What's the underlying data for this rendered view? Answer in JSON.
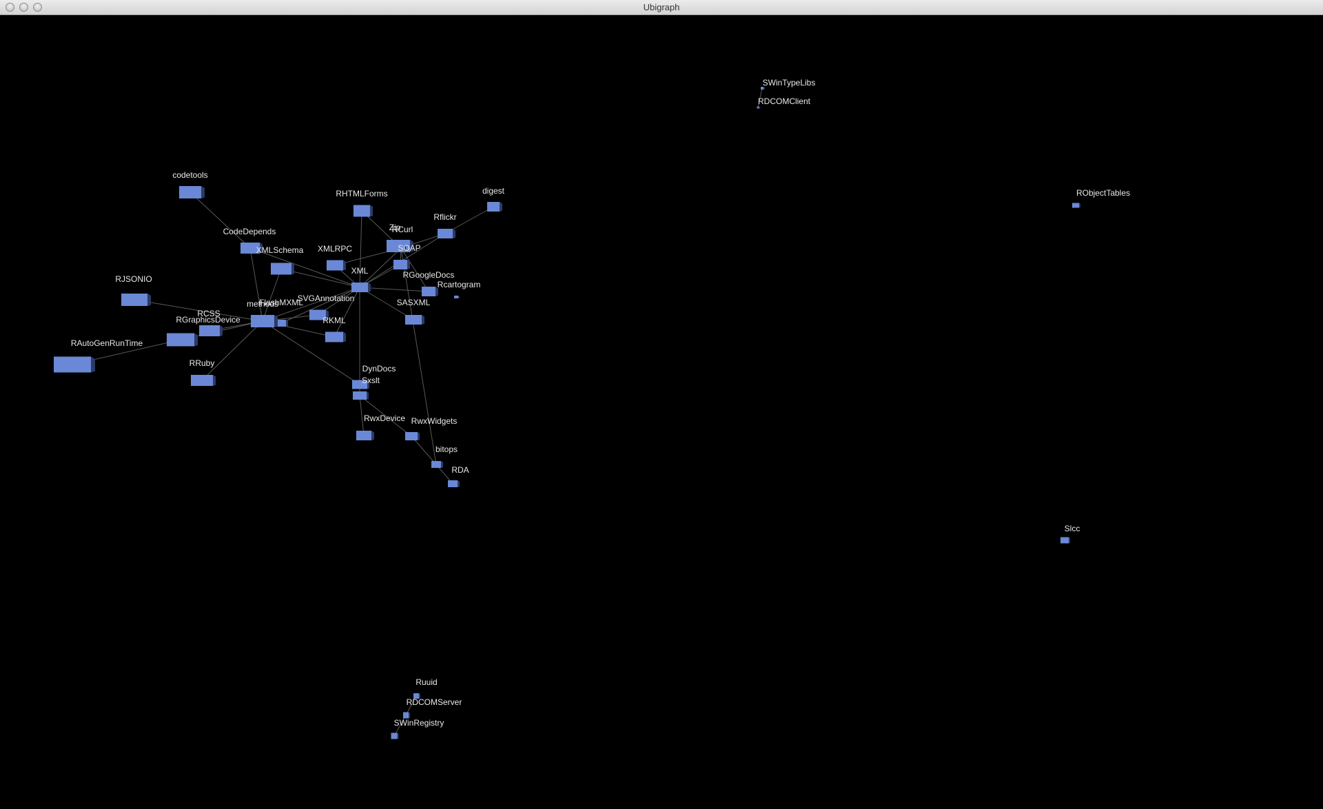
{
  "window": {
    "title": "Ubigraph"
  },
  "graph": {
    "node_color": "#6a88d6",
    "node_shadow": "#2c3b66",
    "edge_color": "#5a5a5a",
    "nodes": [
      {
        "id": "codetools",
        "label": "codetools"
      },
      {
        "id": "CodeDepends",
        "label": "CodeDepends"
      },
      {
        "id": "XMLSchema",
        "label": "XMLSchema"
      },
      {
        "id": "XMLRPC",
        "label": "XMLRPC"
      },
      {
        "id": "RHTMLForms",
        "label": "RHTMLForms"
      },
      {
        "id": "Zip",
        "label": "Zip"
      },
      {
        "id": "RCurl",
        "label": "RCurl"
      },
      {
        "id": "SOAP",
        "label": "SOAP"
      },
      {
        "id": "Rflickr",
        "label": "Rflickr"
      },
      {
        "id": "digest",
        "label": "digest"
      },
      {
        "id": "XML",
        "label": "XML"
      },
      {
        "id": "RGoogleDocs",
        "label": "RGoogleDocs"
      },
      {
        "id": "Rcartogram",
        "label": "Rcartogram"
      },
      {
        "id": "SASXML",
        "label": "SASXML"
      },
      {
        "id": "RJSONIO",
        "label": "RJSONIO"
      },
      {
        "id": "FlashMXML",
        "label": "FlashMXML"
      },
      {
        "id": "methods",
        "label": "methods"
      },
      {
        "id": "SVGAnnotation",
        "label": "SVGAnnotation"
      },
      {
        "id": "RCSS",
        "label": "RCSS"
      },
      {
        "id": "RGraphicsDevice",
        "label": "RGraphicsDevice"
      },
      {
        "id": "RKML",
        "label": "RKML"
      },
      {
        "id": "RAutoGenRunTime",
        "label": "RAutoGenRunTime"
      },
      {
        "id": "RRuby",
        "label": "RRuby"
      },
      {
        "id": "DynDocs",
        "label": "DynDocs"
      },
      {
        "id": "Sxslt",
        "label": "Sxslt"
      },
      {
        "id": "RwxDevice",
        "label": "RwxDevice"
      },
      {
        "id": "RwxWidgets",
        "label": "RwxWidgets"
      },
      {
        "id": "bitops",
        "label": "bitops"
      },
      {
        "id": "RDA",
        "label": "RDA"
      },
      {
        "id": "SWinTypeLibs",
        "label": "SWinTypeLibs"
      },
      {
        "id": "RDCOMClient",
        "label": "RDCOMClient"
      },
      {
        "id": "RObjectTables",
        "label": "RObjectTables"
      },
      {
        "id": "Slcc",
        "label": "Slcc"
      },
      {
        "id": "Ruuid",
        "label": "Ruuid"
      },
      {
        "id": "RDCOMServer",
        "label": "RDCOMServer"
      },
      {
        "id": "SWinRegistry",
        "label": "SWinRegistry"
      }
    ],
    "edges": [
      [
        "codetools",
        "CodeDepends"
      ],
      [
        "CodeDepends",
        "XML"
      ],
      [
        "CodeDepends",
        "methods"
      ],
      [
        "XMLSchema",
        "XML"
      ],
      [
        "XMLSchema",
        "methods"
      ],
      [
        "XMLRPC",
        "XML"
      ],
      [
        "XMLRPC",
        "RCurl"
      ],
      [
        "RHTMLForms",
        "XML"
      ],
      [
        "RHTMLForms",
        "RCurl"
      ],
      [
        "RCurl",
        "XML"
      ],
      [
        "RCurl",
        "bitops"
      ],
      [
        "SOAP",
        "XML"
      ],
      [
        "SOAP",
        "RCurl"
      ],
      [
        "Rflickr",
        "RCurl"
      ],
      [
        "Rflickr",
        "XML"
      ],
      [
        "Rflickr",
        "digest"
      ],
      [
        "RGoogleDocs",
        "XML"
      ],
      [
        "RGoogleDocs",
        "RCurl"
      ],
      [
        "SASXML",
        "XML"
      ],
      [
        "XML",
        "methods"
      ],
      [
        "SVGAnnotation",
        "XML"
      ],
      [
        "SVGAnnotation",
        "methods"
      ],
      [
        "FlashMXML",
        "XML"
      ],
      [
        "FlashMXML",
        "methods"
      ],
      [
        "RKML",
        "XML"
      ],
      [
        "RKML",
        "methods"
      ],
      [
        "RJSONIO",
        "methods"
      ],
      [
        "RCSS",
        "methods"
      ],
      [
        "RGraphicsDevice",
        "methods"
      ],
      [
        "RAutoGenRunTime",
        "RGraphicsDevice"
      ],
      [
        "RRuby",
        "methods"
      ],
      [
        "DynDocs",
        "XML"
      ],
      [
        "DynDocs",
        "methods"
      ],
      [
        "DynDocs",
        "Sxslt"
      ],
      [
        "Sxslt",
        "XML"
      ],
      [
        "RwxDevice",
        "Sxslt"
      ],
      [
        "RwxWidgets",
        "Sxslt"
      ],
      [
        "RwxWidgets",
        "bitops"
      ],
      [
        "bitops",
        "RDA"
      ],
      [
        "SWinTypeLibs",
        "RDCOMClient"
      ],
      [
        "Ruuid",
        "RDCOMServer"
      ],
      [
        "RDCOMServer",
        "SWinRegistry"
      ]
    ]
  }
}
